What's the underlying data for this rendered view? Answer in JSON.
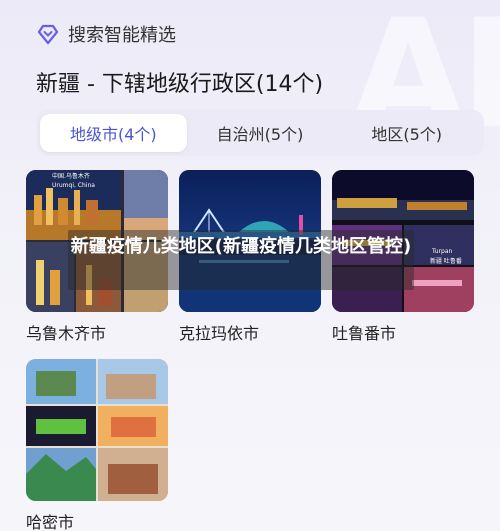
{
  "watermark": "AI",
  "header": {
    "brand_icon": "diamond-icon",
    "brand_text": "搜索智能精选",
    "accent": "#6b5ce7"
  },
  "title": "新疆 - 下辖地级行政区(14个)",
  "tabs": [
    {
      "label": "地级市(4个)",
      "active": true
    },
    {
      "label": "自治州(5个)",
      "active": false
    },
    {
      "label": "地区(5个)",
      "active": false
    }
  ],
  "cities": [
    {
      "name": "乌鲁木齐市",
      "photo_text_1": "中国.乌鲁木齐",
      "photo_text_2": "Urumqi, China"
    },
    {
      "name": "克拉玛依市"
    },
    {
      "name": "吐鲁番市",
      "photo_text_1": "Turpan",
      "photo_text_2": "新疆 吐鲁番"
    },
    {
      "name": "哈密市"
    }
  ],
  "overlay_text": "新疆疫情几类地区(新疆疫情几类地区管控)",
  "active_tab_color": "#4a55d6"
}
